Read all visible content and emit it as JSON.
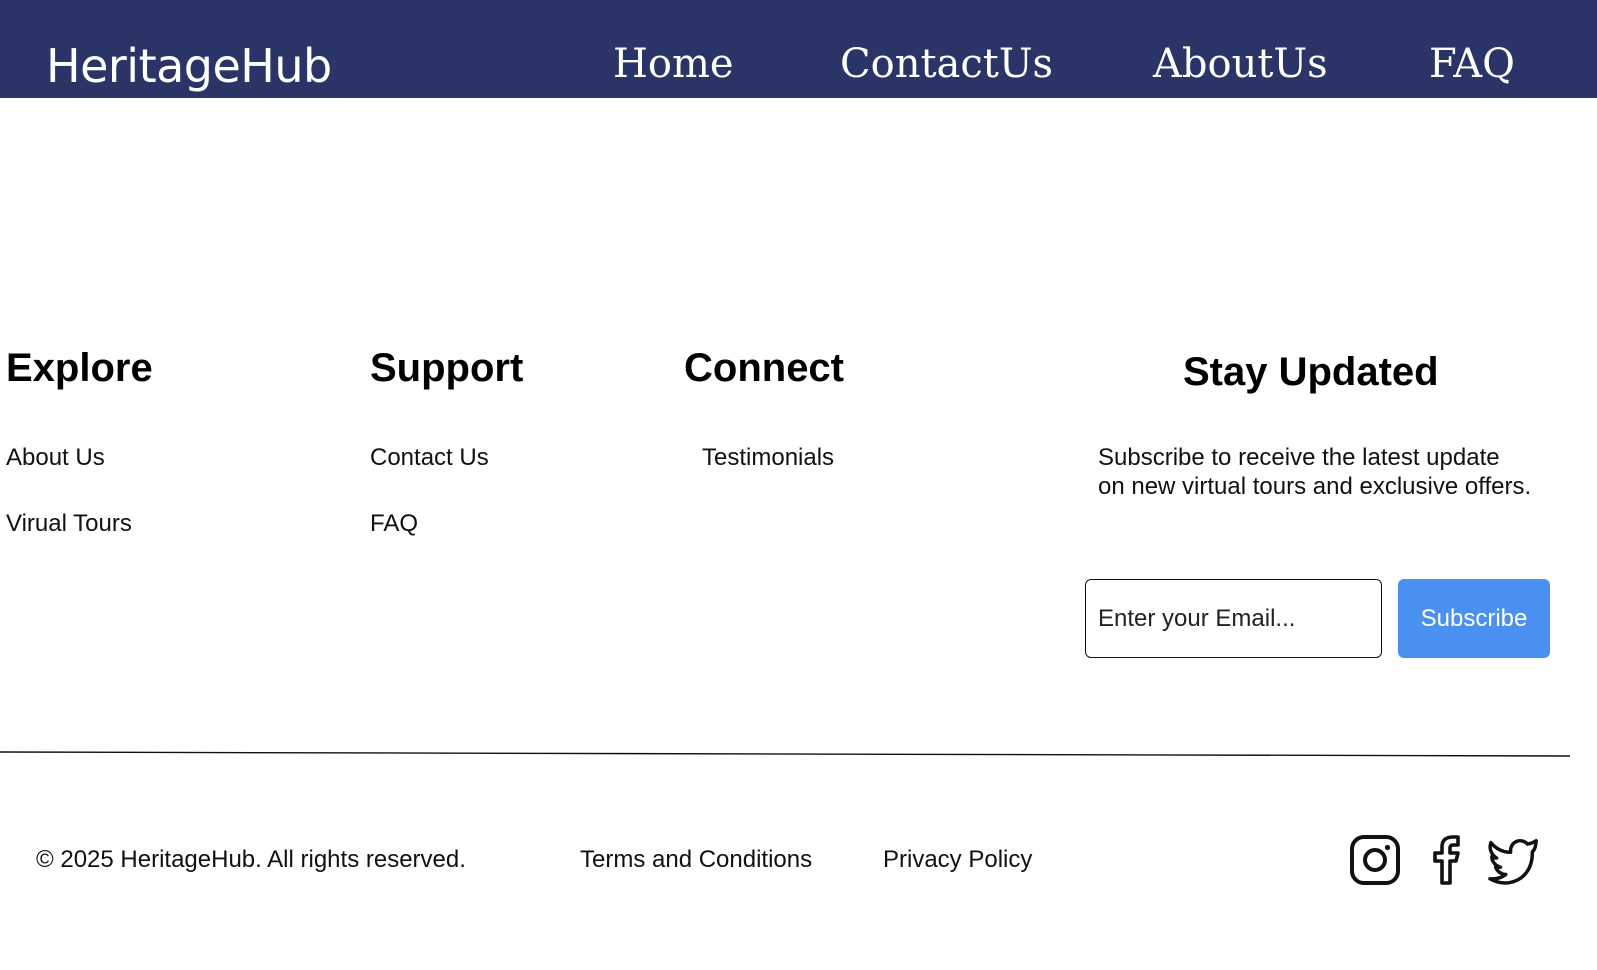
{
  "header": {
    "brand": "HeritageHub",
    "nav": [
      "Home",
      "ContactUs",
      "AboutUs",
      "FAQ"
    ],
    "background_color": "#2b3467"
  },
  "footer": {
    "columns": [
      {
        "title": "Explore",
        "links": [
          "About Us",
          "Virual Tours"
        ]
      },
      {
        "title": "Support",
        "links": [
          "Contact Us",
          "FAQ"
        ]
      },
      {
        "title": "Connect",
        "links": [
          "Testimonials"
        ]
      }
    ],
    "newsletter": {
      "title": "Stay Updated",
      "description_line1": "Subscribe to receive the latest update",
      "description_line2": "on new virtual tours and exclusive offers.",
      "email_placeholder": "Enter your Email...",
      "email_value": "",
      "button_label": "Subscribe",
      "button_color": "#4a90f0"
    },
    "copyright": "© 2025 HeritageHub. All rights reserved.",
    "legal_links": [
      "Terms and Conditions",
      "Privacy Policy"
    ],
    "social_icons": [
      "instagram-icon",
      "facebook-icon",
      "twitter-icon"
    ]
  }
}
